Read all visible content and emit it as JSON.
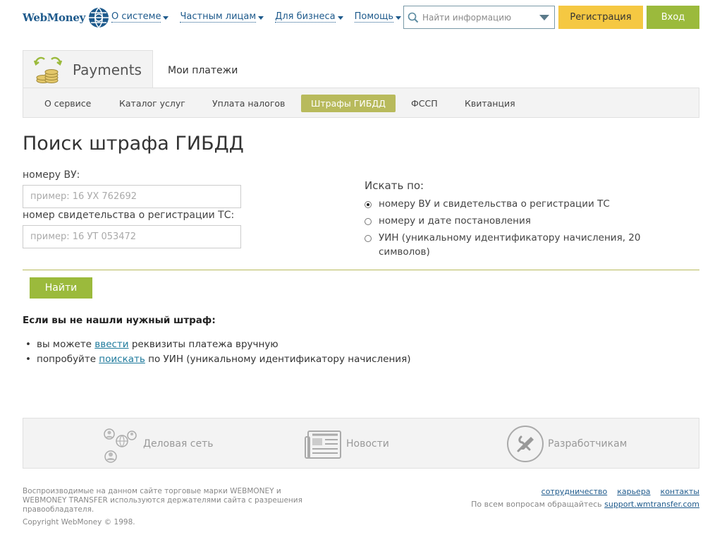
{
  "header": {
    "logo_text": "WebMoney",
    "nav": [
      {
        "label": "О системе"
      },
      {
        "label": "Частным лицам"
      },
      {
        "label": "Для бизнеса"
      },
      {
        "label": "Помощь"
      }
    ],
    "search_placeholder": "Найти информацию",
    "register_label": "Регистрация",
    "login_label": "Вход"
  },
  "service": {
    "title": "Payments",
    "tab2": "Мои платежи",
    "subnav": [
      "О сервисе",
      "Каталог услуг",
      "Уплата налогов",
      "Штрафы ГИБДД",
      "ФССП",
      "Квитанция"
    ],
    "active_index": 3
  },
  "main": {
    "title": "Поиск штрафа ГИБДД",
    "field1_label": "номеру ВУ:",
    "field1_placeholder": "пример: 16 УХ 762692",
    "field2_label": "номер свидетельства о регистрации ТС:",
    "field2_placeholder": "пример: 16 УТ 053472",
    "search_by_label": "Искать по:",
    "options": [
      "номеру ВУ и свидетельства о регистрации ТС",
      "номеру и дате постановления",
      "УИН (уникальному идентификатору начисления, 20 символов)"
    ],
    "selected_option": 0,
    "find_button": "Найти",
    "help_title": "Если вы не нашли нужный штраф:",
    "help_1_pre": "вы можете ",
    "help_1_link": "ввести",
    "help_1_post": " реквизиты платежа вручную",
    "help_2_pre": "попробуйте ",
    "help_2_link": "поискать",
    "help_2_post": " по УИН (уникальному идентификатору начисления)"
  },
  "footer": {
    "items": [
      "Деловая сеть",
      "Новости",
      "Разработчикам"
    ],
    "legal": "Воспроизводимые на данном сайте торговые марки WEBMONEY и WEBMONEY TRANSFER используются держателями сайта с разрешения правообладателя.",
    "copyright": "Copyright WebMoney © 1998.",
    "links": [
      "сотрудничество",
      "карьера",
      "контакты"
    ],
    "support_text": "По всем вопросам обращайтесь ",
    "support_link": "support.wmtransfer.com"
  },
  "colors": {
    "brand_blue": "#1e5a8c",
    "accent_green": "#9bba3c",
    "accent_yellow": "#f5c842",
    "active_tab": "#b8ba5c"
  }
}
